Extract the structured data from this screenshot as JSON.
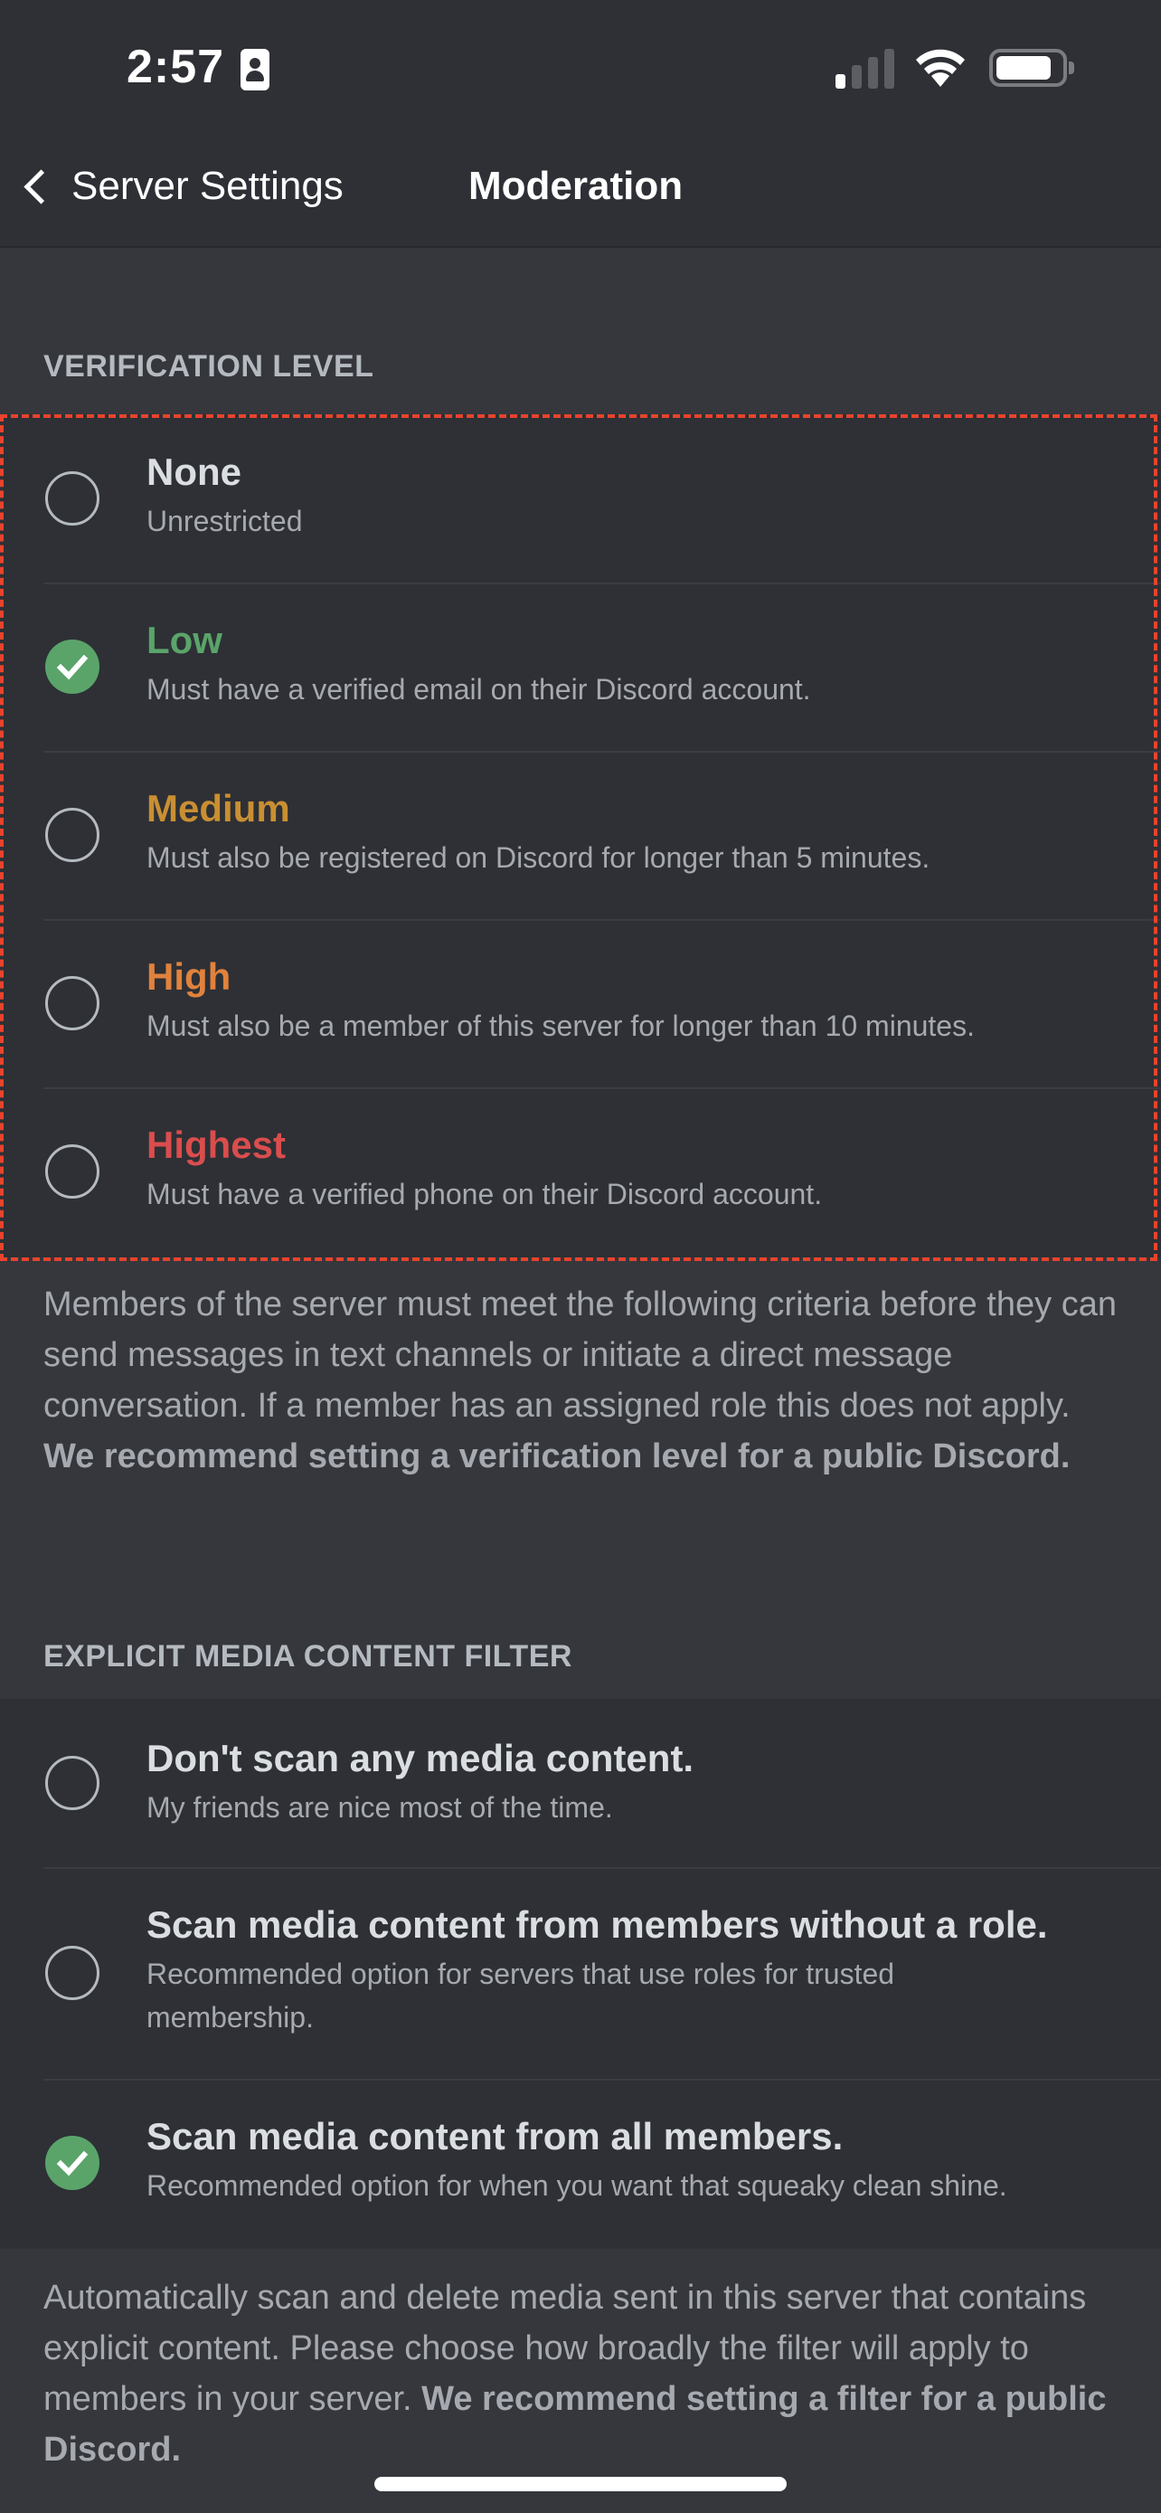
{
  "status_bar": {
    "time": "2:57",
    "icons": [
      "contact-card-icon",
      "cellular-signal-icon",
      "wifi-icon",
      "battery-icon"
    ]
  },
  "nav": {
    "back_label": "Server Settings",
    "title": "Moderation"
  },
  "verification": {
    "header": "VERIFICATION LEVEL",
    "selected": "Low",
    "options": [
      {
        "title": "None",
        "subtitle": "Unrestricted",
        "color": "#dbdee1",
        "checked": false
      },
      {
        "title": "Low",
        "subtitle": "Must have a verified email on their Discord account.",
        "color": "#5aa46a",
        "checked": true
      },
      {
        "title": "Medium",
        "subtitle": "Must also be registered on Discord for longer than 5 minutes.",
        "color": "#c98f32",
        "checked": false
      },
      {
        "title": "High",
        "subtitle": "Must also be a member of this server for longer than 10 minutes.",
        "color": "#e0823d",
        "checked": false
      },
      {
        "title": "Highest",
        "subtitle": "Must have a verified phone on their Discord account.",
        "color": "#da4d4d",
        "checked": false
      }
    ],
    "description": "Members of the server must meet the following criteria before they can send messages in text channels or initiate a direct message conversation. If a member has an assigned role this does not apply.",
    "recommendation": "We recommend setting a verification level for a public Discord."
  },
  "media_filter": {
    "header": "EXPLICIT MEDIA CONTENT FILTER",
    "selected": "Scan media content from all members.",
    "options": [
      {
        "title": "Don't scan any media content.",
        "subtitle": "My friends are nice most of the time.",
        "checked": false
      },
      {
        "title": "Scan media content from members without a role.",
        "subtitle": "Recommended option for servers that use roles for trusted membership.",
        "checked": false
      },
      {
        "title": "Scan media content from all members.",
        "subtitle": "Recommended option for when you want that squeaky clean shine.",
        "checked": true
      }
    ],
    "description": "Automatically scan and delete media sent in this server that contains explicit content. Please choose how broadly the filter will apply to members in your server.",
    "recommendation": "We recommend setting a filter for a public Discord."
  },
  "colors": {
    "accent_green": "#5aa46a",
    "highlight_border": "#e8432d"
  }
}
